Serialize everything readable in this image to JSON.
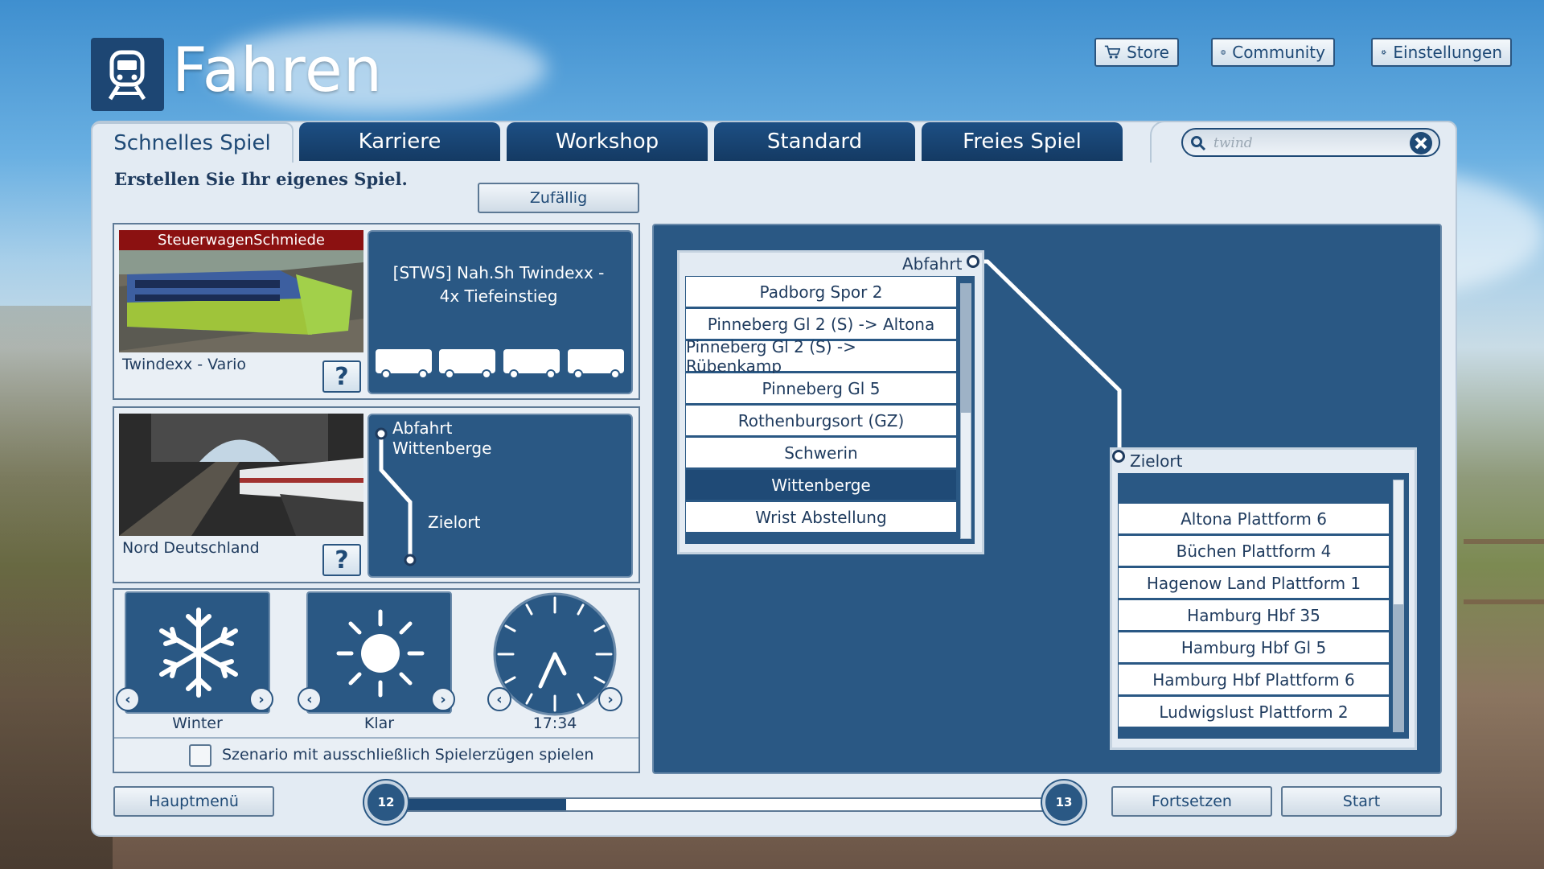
{
  "app": {
    "title": "Fahren"
  },
  "top_buttons": {
    "store": "Store",
    "community": "Community",
    "settings": "Einstellungen"
  },
  "tabs": [
    {
      "label": "Schnelles Spiel",
      "active": true
    },
    {
      "label": "Karriere",
      "active": false
    },
    {
      "label": "Workshop",
      "active": false
    },
    {
      "label": "Standard",
      "active": false
    },
    {
      "label": "Freies Spiel",
      "active": false
    }
  ],
  "search": {
    "value": "twind"
  },
  "main": {
    "subtitle": "Erstellen Sie Ihr eigenes Spiel.",
    "random_button": "Zufällig"
  },
  "train": {
    "banner": "SteuerwagenSchmiede",
    "name": "Twindexx - Vario",
    "detail": "[STWS] Nah.Sh Twindexx - 4x Tiefeinstieg",
    "help": "?"
  },
  "route": {
    "name": "Nord Deutschland",
    "start_label": "Abfahrt",
    "start_value": "Wittenberge",
    "dest_label": "Zielort",
    "help": "?"
  },
  "conditions": {
    "season": "Winter",
    "weather": "Klar",
    "time": "17:34",
    "player_only_label": "Szenario mit ausschließlich Spielerzügen spielen"
  },
  "departure": {
    "label": "Abfahrt",
    "items": [
      "Padborg Spor 2",
      "Pinneberg Gl 2 (S) -> Altona",
      "Pinneberg Gl 2 (S) -> Rübenkamp",
      "Pinneberg Gl 5",
      "Rothenburgsort (GZ)",
      "Schwerin",
      "Wittenberge",
      "Wrist Abstellung"
    ],
    "selected": "Wittenberge"
  },
  "destination": {
    "label": "Zielort",
    "items": [
      "Altona Plattform 6",
      "Büchen Plattform 4",
      "Hagenow Land Plattform 1",
      "Hamburg Hbf 35",
      "Hamburg Hbf Gl 5",
      "Hamburg Hbf Plattform 6",
      "Ludwigslust Plattform 2"
    ]
  },
  "footer": {
    "main_menu": "Hauptmenü",
    "continue": "Fortsetzen",
    "start": "Start",
    "step_current": "12",
    "step_next": "13",
    "progress": 0.25
  },
  "icons": [
    "train-logo-icon",
    "cart-icon",
    "globe-icon",
    "gear-icon",
    "search-icon",
    "close-icon",
    "snowflake-icon",
    "sun-icon",
    "clock-icon",
    "chevron-left-icon",
    "chevron-right-icon"
  ]
}
